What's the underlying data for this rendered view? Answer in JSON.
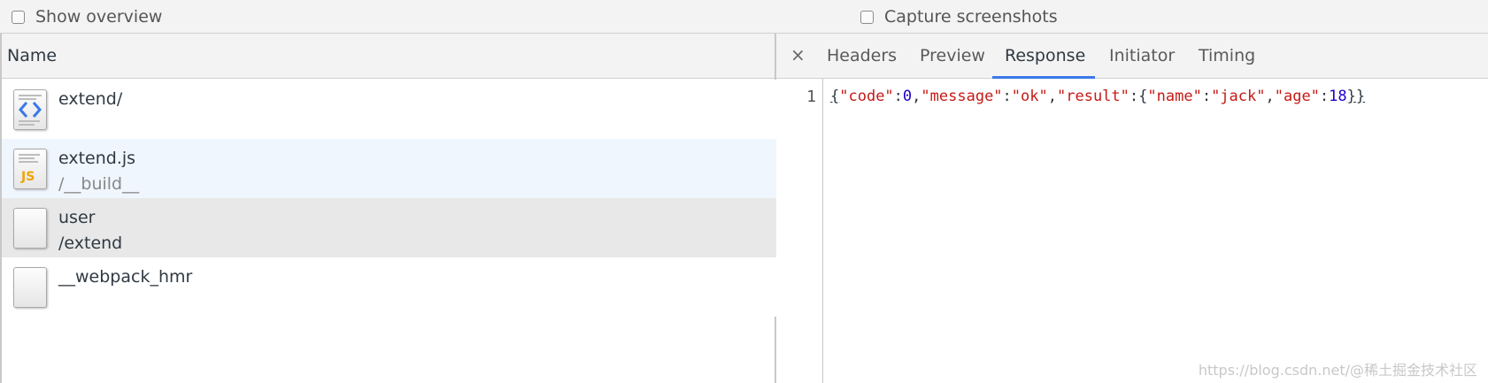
{
  "toolbar": {
    "show_overview": "Show overview",
    "capture_screenshots": "Capture screenshots"
  },
  "requests": {
    "header": "Name",
    "rows": [
      {
        "name": "extend/",
        "path": "",
        "icon": "html-doc-icon"
      },
      {
        "name": "extend.js",
        "path": "/__build__",
        "icon": "js-file-icon"
      },
      {
        "name": "user",
        "path": "/extend",
        "icon": "blank-file-icon"
      },
      {
        "name": "__webpack_hmr",
        "path": "",
        "icon": "blank-file-icon"
      }
    ]
  },
  "detail": {
    "close": "×",
    "tabs": [
      "Headers",
      "Preview",
      "Response",
      "Initiator",
      "Timing"
    ],
    "active_tab": "Response",
    "line_number": "1",
    "code": {
      "open": "{",
      "k1": "\"code\"",
      "v1": "0",
      "k2": "\"message\"",
      "v2": "\"ok\"",
      "k3": "\"result\"",
      "open2": "{",
      "k4": "\"name\"",
      "v4": "\"jack\"",
      "k5": "\"age\"",
      "v5": "18",
      "close": "}}"
    }
  },
  "watermark": "https://blog.csdn.net/@稀土掘金技术社区",
  "colors": {
    "accent": "#3b78e7",
    "string": "#c41a16",
    "number": "#1c00cf",
    "selected_row": "#e8e8e8",
    "hover_row": "#f0f6fe"
  }
}
